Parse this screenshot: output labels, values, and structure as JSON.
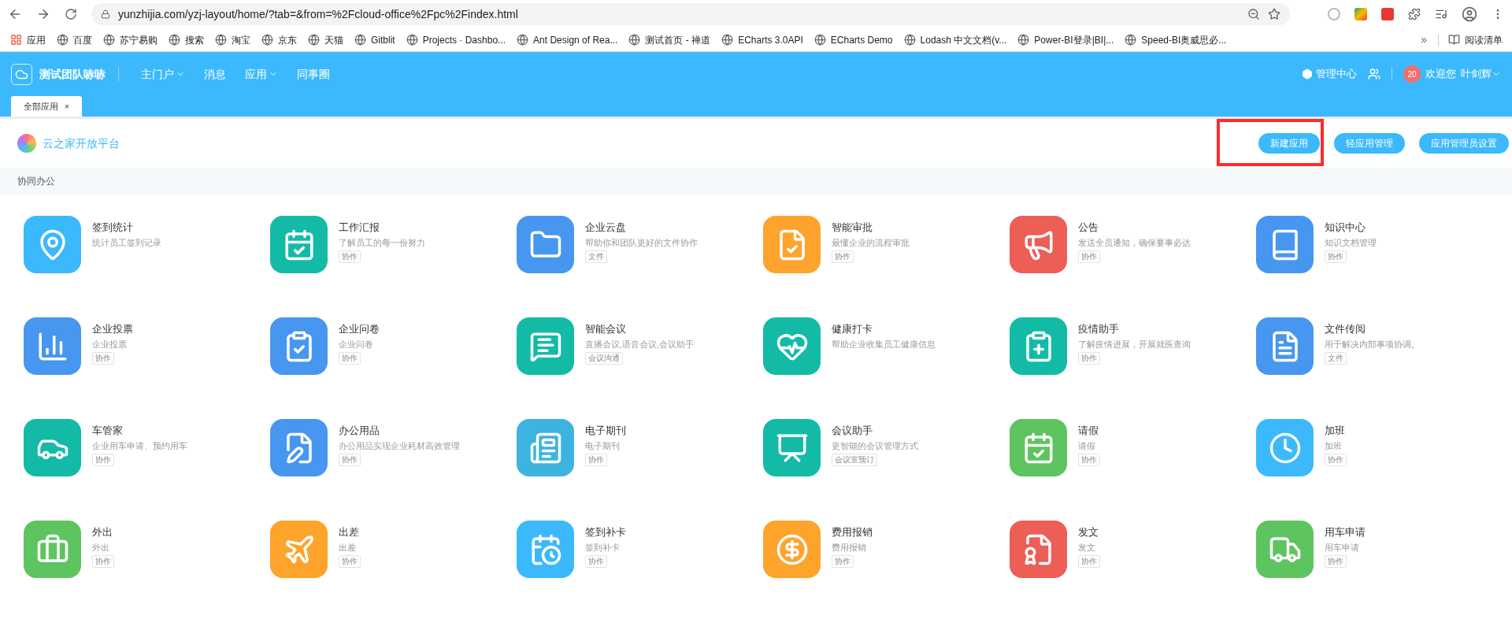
{
  "browser": {
    "url": "yunzhijia.com/yzj-layout/home/?tab=&from=%2Fcloud-office%2Fpc%2Findex.html",
    "bookmarks": [
      {
        "kind": "apps",
        "label": "应用"
      },
      {
        "kind": "site",
        "label": "百度"
      },
      {
        "kind": "site",
        "label": "苏宁易购"
      },
      {
        "kind": "site",
        "label": "搜索"
      },
      {
        "kind": "site",
        "label": "淘宝"
      },
      {
        "kind": "site",
        "label": "京东"
      },
      {
        "kind": "site",
        "label": "天猫"
      },
      {
        "kind": "site",
        "label": "Gitblit"
      },
      {
        "kind": "site",
        "label": "Projects · Dashbo..."
      },
      {
        "kind": "site",
        "label": "Ant Design of Rea..."
      },
      {
        "kind": "site",
        "label": "测试首页 - 禅道"
      },
      {
        "kind": "site",
        "label": "ECharts 3.0API"
      },
      {
        "kind": "site",
        "label": "ECharts Demo"
      },
      {
        "kind": "site",
        "label": "Lodash 中文文档(v..."
      },
      {
        "kind": "site",
        "label": "Power-BI登录|BI|..."
      },
      {
        "kind": "site",
        "label": "Speed-BI奥威思必..."
      }
    ],
    "more": "»",
    "reading_list": "阅读清单"
  },
  "header": {
    "team": "测试团队哧哧",
    "nav": [
      {
        "label": "主门户",
        "dropdown": true
      },
      {
        "label": "消息",
        "dropdown": false
      },
      {
        "label": "应用",
        "dropdown": true
      },
      {
        "label": "同事圈",
        "dropdown": false
      }
    ],
    "admin": "管理中心",
    "badge": "20",
    "welcome": "欢迎您",
    "user": "叶剑辉"
  },
  "tabs": [
    {
      "label": "全部应用",
      "close": "×",
      "selected": true
    }
  ],
  "platform": {
    "title": "云之家开放平台",
    "buttons": [
      {
        "label": "新建应用",
        "highlighted": true
      },
      {
        "label": "轻应用管理",
        "highlighted": false
      },
      {
        "label": "应用管理员设置",
        "highlighted": false
      }
    ]
  },
  "section": "协同办公",
  "apps": [
    {
      "name": "签到统计",
      "desc": "统计员工签到记录",
      "color": "#3cb9fc"
    },
    {
      "name": "工作汇报",
      "desc": "了解员工的每一份努力",
      "tag": "协作",
      "color": "#13bba7"
    },
    {
      "name": "企业云盘",
      "desc": "帮助你和团队更好的文件协作",
      "tag": "文件",
      "color": "#4797f0"
    },
    {
      "name": "智能审批",
      "desc": "最懂企业的流程审批",
      "tag": "协作",
      "color": "#fea32c"
    },
    {
      "name": "公告",
      "desc": "发送全员通知，确保要事必达",
      "tag": "协作",
      "color": "#ec5e56"
    },
    {
      "name": "知识中心",
      "desc": "知识文档管理",
      "tag": "协作",
      "color": "#4797f0"
    },
    {
      "name": "企业投票",
      "desc": "企业投票",
      "tag": "协作",
      "color": "#4797f0"
    },
    {
      "name": "企业问卷",
      "desc": "企业问卷",
      "tag": "协作",
      "color": "#4797f0"
    },
    {
      "name": "智能会议",
      "desc": "直播会议,语音会议,会议助手",
      "tag": "会议沟通",
      "color": "#13bba7"
    },
    {
      "name": "健康打卡",
      "desc": "帮助企业收集员工健康信息",
      "color": "#13bba7"
    },
    {
      "name": "疫情助手",
      "desc": "了解疫情进展，开展就医查询",
      "tag": "协作",
      "color": "#13bba7"
    },
    {
      "name": "文件传阅",
      "desc": "用于解决内部事项协调。",
      "tag": "文件",
      "color": "#4797f0"
    },
    {
      "name": "车管家",
      "desc": "企业用车申请、预约用车",
      "tag": "协作",
      "color": "#13bba7"
    },
    {
      "name": "办公用品",
      "desc": "办公用品实现企业耗材高效管理",
      "tag": "协作",
      "color": "#4797f0"
    },
    {
      "name": "电子期刊",
      "desc": "电子期刊",
      "tag": "协作",
      "color": "#3db4e0"
    },
    {
      "name": "会议助手",
      "desc": "更智能的会议管理方式",
      "tag": "会议室预订",
      "color": "#13bba7"
    },
    {
      "name": "请假",
      "desc": "请假",
      "tag": "协作",
      "color": "#5ec460"
    },
    {
      "name": "加班",
      "desc": "加班",
      "tag": "协作",
      "color": "#3cb9fc"
    },
    {
      "name": "外出",
      "desc": "外出",
      "tag": "协作",
      "color": "#5ec460"
    },
    {
      "name": "出差",
      "desc": "出差",
      "tag": "协作",
      "color": "#fea32c"
    },
    {
      "name": "签到补卡",
      "desc": "签到补卡",
      "tag": "协作",
      "color": "#3cb9fc"
    },
    {
      "name": "费用报销",
      "desc": "费用报销",
      "tag": "协作",
      "color": "#fea32c"
    },
    {
      "name": "发文",
      "desc": "发文",
      "tag": "协作",
      "color": "#ec5e56"
    },
    {
      "name": "用车申请",
      "desc": "用车申请",
      "tag": "协作",
      "color": "#5ec460"
    }
  ]
}
